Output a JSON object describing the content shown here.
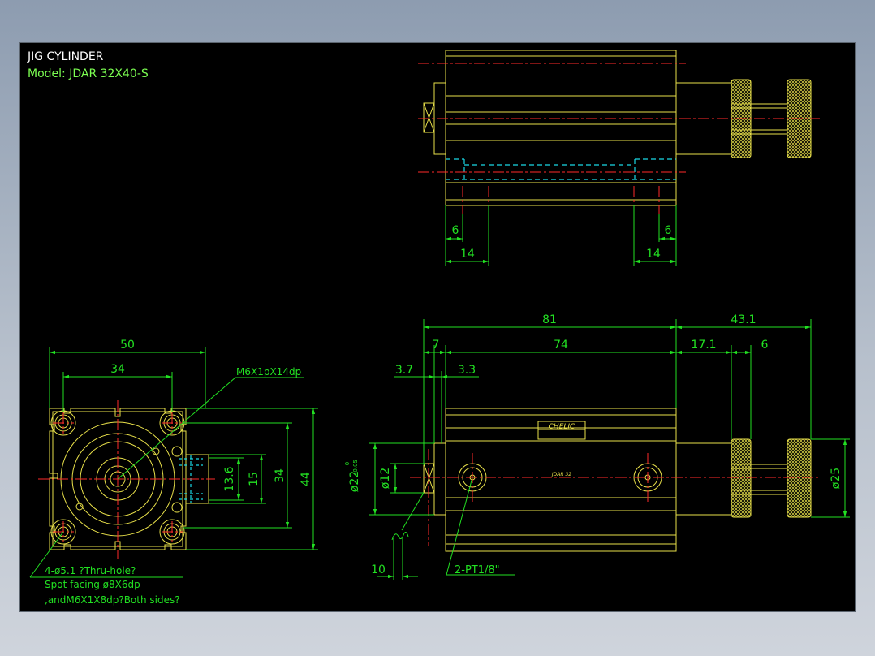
{
  "title": {
    "line1": "JIG CYLINDER",
    "line2": "Model:  JDAR 32X40-S"
  },
  "colors": {
    "background": "#000000",
    "outline": "#e8e04a",
    "dimension": "#22e022",
    "centerline": "#ff2a2a",
    "hidden": "#19d9e6",
    "title_white": "#ffffff",
    "title_green": "#7cff52"
  },
  "top_view": {
    "dims": {
      "d6_left": "6",
      "d14_left": "14",
      "d14_right": "14",
      "d6_right": "6"
    }
  },
  "front_view": {
    "dims": {
      "d81": "81",
      "d43_1": "43.1",
      "d7": "7",
      "d74": "74",
      "d17_1": "17.1",
      "d6": "6",
      "d3_7": "3.7",
      "d3_3": "3.3",
      "d22_tol_top": "0",
      "d22_tol_bottom": "-0.05",
      "d22": "ø22",
      "d12": "ø12",
      "d25": "ø25",
      "d10": "10"
    },
    "label_brand": "CHELIC",
    "label_model": "JDAR 32",
    "callout_port": "2-PT1/8\""
  },
  "side_view": {
    "dims": {
      "d50": "50",
      "d34_top": "34",
      "d13_6": "13.6",
      "d15": "15",
      "d34_right": "34",
      "d44": "44"
    },
    "callout_thread": "M6X1pX14dp",
    "callout_holes_1": "4-ø5.1 ?Thru-hole?",
    "callout_holes_2": "Spot facing ø8X6dp",
    "callout_holes_3": ",andM6X1X8dp?Both sides?"
  }
}
